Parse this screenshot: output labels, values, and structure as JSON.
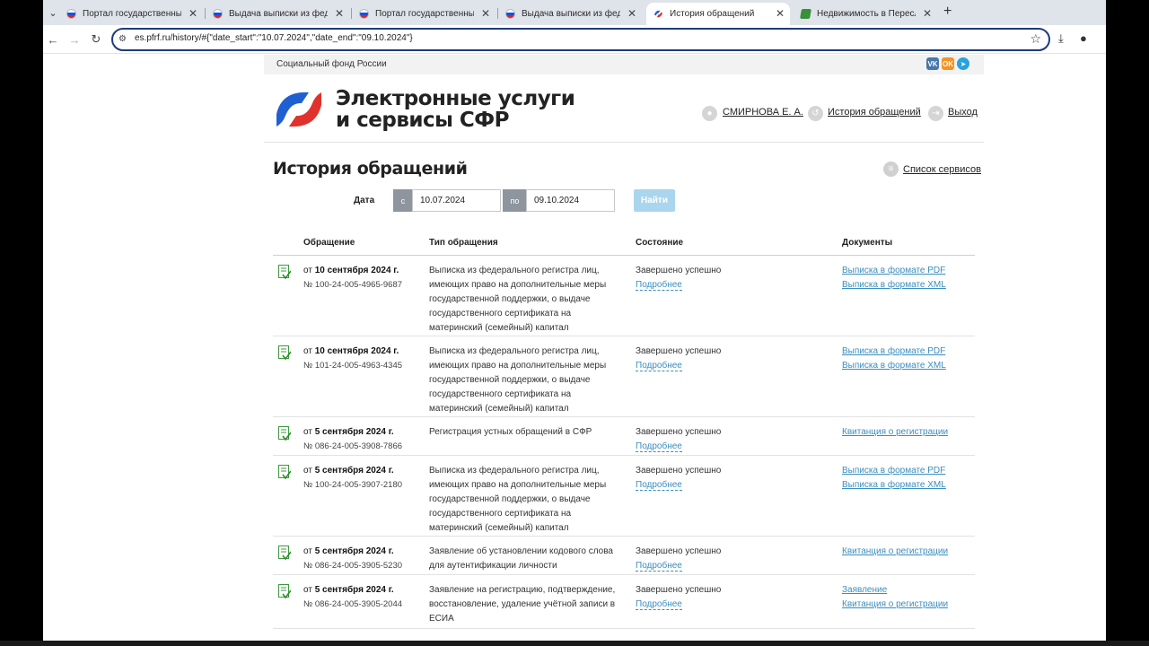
{
  "browser": {
    "tabs": [
      {
        "title": "Портал государственных услуг",
        "icon": "russia-flag-icon",
        "active": false
      },
      {
        "title": "Выдача выписки из федерального",
        "icon": "russia-flag-icon",
        "active": false
      },
      {
        "title": "Портал государственных услуг",
        "icon": "russia-flag-icon",
        "active": false
      },
      {
        "title": "Выдача выписки из федерального",
        "icon": "russia-flag-icon",
        "active": false
      },
      {
        "title": "История обращений",
        "icon": "sfr-logo-icon",
        "active": true
      },
      {
        "title": "Недвижимость в Переславле",
        "icon": "green-leaf-icon",
        "active": false
      }
    ],
    "url": "es.pfrf.ru/history/#{\"date_start\":\"10.07.2024\",\"date_end\":\"09.10.2024\"}"
  },
  "site": {
    "org_name": "Социальный фонд России",
    "social": [
      "VK",
      "OK"
    ],
    "brand_line1": "Электронные услуги",
    "brand_line2": "и сервисы СФР",
    "user_name": "СМИРНОВА Е. А.",
    "history_link": "История обращений",
    "logout": "Выход"
  },
  "main": {
    "title": "История обращений",
    "services_link": "Список сервисов",
    "filter": {
      "label": "Дата",
      "from_prefix": "с",
      "from_value": "10.07.2024",
      "to_prefix": "по",
      "to_value": "09.10.2024",
      "find_button": "Найти"
    },
    "columns": [
      "Обращение",
      "Тип обращения",
      "Состояние",
      "Документы"
    ],
    "rows": [
      {
        "date_prefix": "от",
        "date": "10 сентября 2024 г.",
        "number": "№ 100-24-005-4965-9687",
        "type": "Выписка из федерального регистра лиц, имеющих право на дополнительные меры государственной поддержки, о выдаче государственного сертификата на материнский (семейный) капитал",
        "status": "Завершено успешно",
        "more": "Подробнее",
        "docs": [
          "Выписка в формате PDF",
          "Выписка в формате XML"
        ]
      },
      {
        "date_prefix": "от",
        "date": "10 сентября 2024 г.",
        "number": "№ 101-24-005-4963-4345",
        "type": "Выписка из федерального регистра лиц, имеющих право на дополнительные меры государственной поддержки, о выдаче государственного сертификата на материнский (семейный) капитал",
        "status": "Завершено успешно",
        "more": "Подробнее",
        "docs": [
          "Выписка в формате PDF",
          "Выписка в формате XML"
        ]
      },
      {
        "date_prefix": "от",
        "date": "5 сентября 2024 г.",
        "number": "№ 086-24-005-3908-7866",
        "type": "Регистрация устных обращений в СФР",
        "status": "Завершено успешно",
        "more": "Подробнее",
        "docs": [
          "Квитанция о регистрации"
        ]
      },
      {
        "date_prefix": "от",
        "date": "5 сентября 2024 г.",
        "number": "№ 100-24-005-3907-2180",
        "type": "Выписка из федерального регистра лиц, имеющих право на дополнительные меры государственной поддержки, о выдаче государственного сертификата на материнский (семейный) капитал",
        "status": "Завершено успешно",
        "more": "Подробнее",
        "docs": [
          "Выписка в формате PDF",
          "Выписка в формате XML"
        ]
      },
      {
        "date_prefix": "от",
        "date": "5 сентября 2024 г.",
        "number": "№ 086-24-005-3905-5230",
        "type": "Заявление об установлении кодового слова для аутентификации личности",
        "status": "Завершено успешно",
        "more": "Подробнее",
        "docs": [
          "Квитанция о регистрации"
        ]
      },
      {
        "date_prefix": "от",
        "date": "5 сентября 2024 г.",
        "number": "№ 086-24-005-3905-2044",
        "type": "Заявление на регистрацию, подтверждение, восстановление, удаление учётной записи в ЕСИА",
        "status": "Завершено успешно",
        "more": "Подробнее",
        "docs": [
          "Заявление",
          "Квитанция о регистрации"
        ]
      }
    ]
  },
  "colors": {
    "link": "#3a8dbd",
    "button_disabled": "#a9d6ee",
    "logo_blue": "#1f5fd1",
    "logo_red": "#e0312c"
  }
}
